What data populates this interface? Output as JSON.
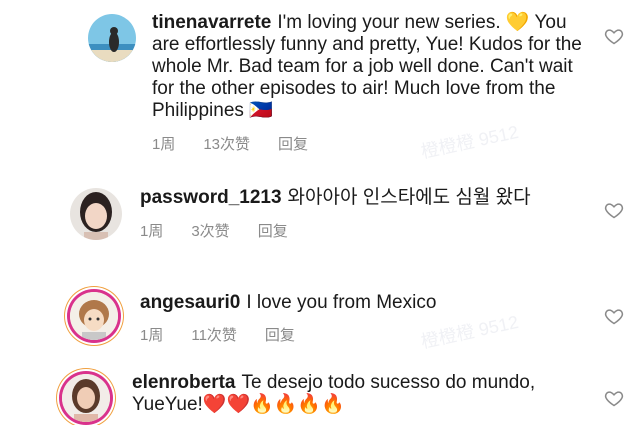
{
  "comments": [
    {
      "username": "tinenavarrete",
      "text": "I'm loving your new series. 💛 You are effortlessly funny and pretty, Yue! Kudos for the whole Mr. Bad team for a job well done. Can't wait for the other episodes to air! Much love from the Philippines 🇵🇭",
      "time": "1周",
      "likes": "13次赞",
      "reply": "回复"
    },
    {
      "username": "password_1213",
      "text": "와아아아 인스타에도 심월 왔다",
      "time": "1周",
      "likes": "3次赞",
      "reply": "回复"
    },
    {
      "username": "angesauri0",
      "text": "I love you from Mexico",
      "time": "1周",
      "likes": "11次赞",
      "reply": "回复"
    },
    {
      "username": "elenroberta",
      "text": "Te desejo todo sucesso do mundo, YueYue!❤️❤️🔥🔥🔥🔥",
      "time": "",
      "likes": "",
      "reply": ""
    }
  ],
  "watermark": "橙橙橙 9512",
  "icons": {
    "like": "heart-outline-icon"
  },
  "colors": {
    "meta": "#8a8a8a",
    "story_ring": "#d9328c"
  }
}
